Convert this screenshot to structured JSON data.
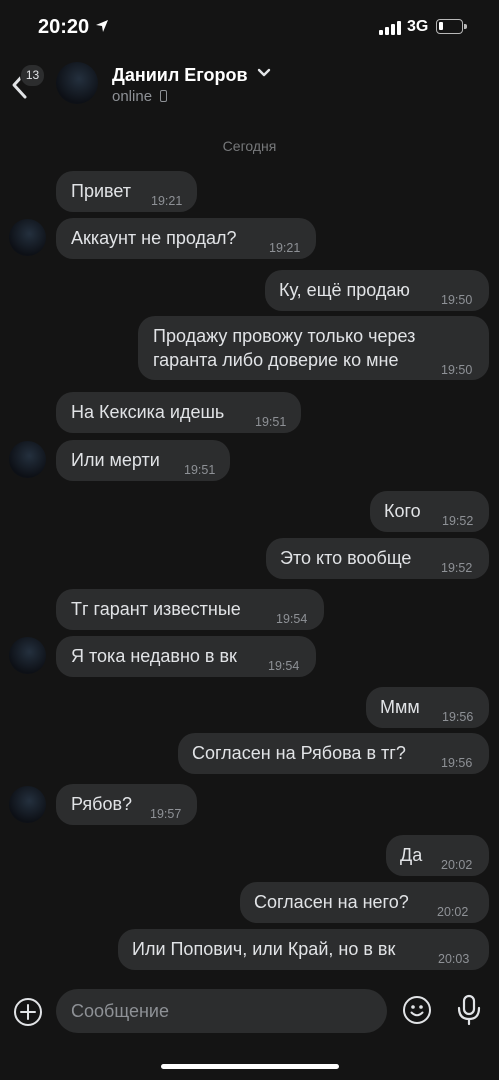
{
  "status_bar": {
    "time": "20:20",
    "network": "3G",
    "battery_level": 0.15
  },
  "header": {
    "unread_count": "13",
    "contact_name": "Даниил Егоров",
    "contact_status": "online"
  },
  "date_separator": "Сегодня",
  "messages": [
    {
      "side": "in",
      "text": "Привет",
      "time": "19:21"
    },
    {
      "side": "in",
      "text": "Аккаунт не продал?",
      "time": "19:21"
    },
    {
      "side": "out",
      "text": "Ку, ещё продаю",
      "time": "19:50"
    },
    {
      "side": "out",
      "text_lines": [
        "Продажу провожу только через",
        "гаранта либо доверие ко мне"
      ],
      "time": "19:50"
    },
    {
      "side": "in",
      "text": "На Кексика идешь",
      "time": "19:51"
    },
    {
      "side": "in",
      "text": "Или мерти",
      "time": "19:51"
    },
    {
      "side": "out",
      "text": "Кого",
      "time": "19:52"
    },
    {
      "side": "out",
      "text": "Это кто вообще",
      "time": "19:52"
    },
    {
      "side": "in",
      "text": "Тг гарант известные",
      "time": "19:54"
    },
    {
      "side": "in",
      "text": "Я тока недавно в вк",
      "time": "19:54"
    },
    {
      "side": "out",
      "text": "Ммм",
      "time": "19:56"
    },
    {
      "side": "out",
      "text": "Согласен на Рябова в тг?",
      "time": "19:56"
    },
    {
      "side": "in",
      "text": "Рябов?",
      "time": "19:57"
    },
    {
      "side": "out",
      "text": "Да",
      "time": "20:02"
    },
    {
      "side": "out",
      "text": "Согласен на него?",
      "time": "20:02"
    },
    {
      "side": "out",
      "text": "Или Попович, или Край, но в вк",
      "time": "20:03"
    }
  ],
  "composer": {
    "placeholder": "Сообщение"
  },
  "icons": [
    "location-arrow-icon",
    "signal-icon",
    "battery-icon",
    "back-chevron-icon",
    "chevron-down-icon",
    "phone-icon",
    "plus-icon",
    "smile-icon",
    "microphone-icon"
  ]
}
